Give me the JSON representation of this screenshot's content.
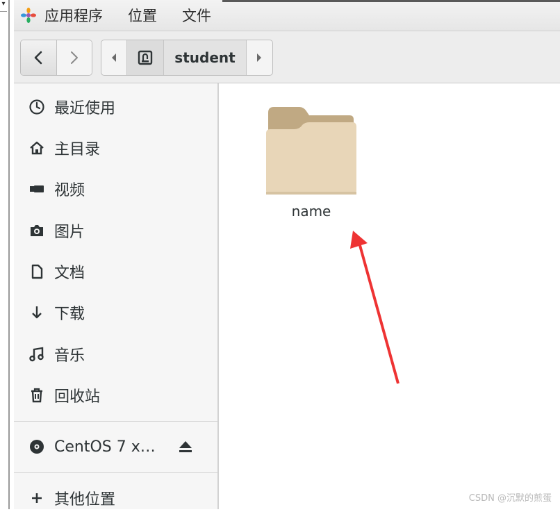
{
  "menubar": {
    "items": [
      "应用程序",
      "位置",
      "文件"
    ]
  },
  "pathbar": {
    "current": "student"
  },
  "sidebar": {
    "items": [
      {
        "label": "最近使用",
        "icon": "clock-icon"
      },
      {
        "label": "主目录",
        "icon": "home-icon"
      },
      {
        "label": "视频",
        "icon": "video-icon"
      },
      {
        "label": "图片",
        "icon": "camera-icon"
      },
      {
        "label": "文档",
        "icon": "document-icon"
      },
      {
        "label": "下载",
        "icon": "download-icon"
      },
      {
        "label": "音乐",
        "icon": "music-icon"
      },
      {
        "label": "回收站",
        "icon": "trash-icon"
      }
    ],
    "devices": [
      {
        "label": "CentOS 7 x…",
        "icon": "disc-icon"
      }
    ],
    "other": {
      "label": "其他位置",
      "icon": "plus-icon"
    }
  },
  "content": {
    "files": [
      {
        "name": "name",
        "icon": "folder-icon"
      }
    ]
  },
  "annotation": {
    "color": "#ee3333"
  },
  "watermark": "CSDN @沉默的煎蛋"
}
